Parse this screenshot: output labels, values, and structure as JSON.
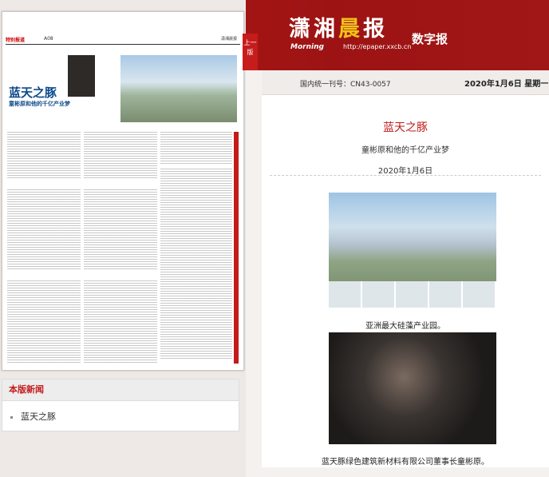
{
  "masthead": {
    "name_part1": "潇湘",
    "name_part2": "晨",
    "name_part3": "报",
    "name_en": "Morning",
    "digital_label": "数字报",
    "url": "http://epaper.xxcb.cn"
  },
  "side_tab": {
    "label": "上一版"
  },
  "paper_page": {
    "section": "特别报道",
    "page_number": "A08",
    "headline": "蓝天之豚",
    "subheadline": "童彬原和他的千亿产业梦",
    "brand": "潇湘晨报"
  },
  "info_bar": {
    "issn": "国内统一刊号：CN43-0057",
    "date": "2020年1月6日 星期一"
  },
  "article": {
    "title": "蓝天之豚",
    "subtitle": "童彬原和他的千亿产业梦",
    "date": "2020年1月6日",
    "caption1": "亚洲最大硅藻产业园。",
    "caption2": "蓝天豚绿色建筑新材料有限公司董事长童彬原。"
  },
  "news_box": {
    "header": "本版新闻",
    "items": [
      "蓝天之豚"
    ]
  },
  "colors": {
    "brand_red": "#b41a1a",
    "accent_gold": "#f2c21b",
    "title_red": "#c31a1a"
  }
}
